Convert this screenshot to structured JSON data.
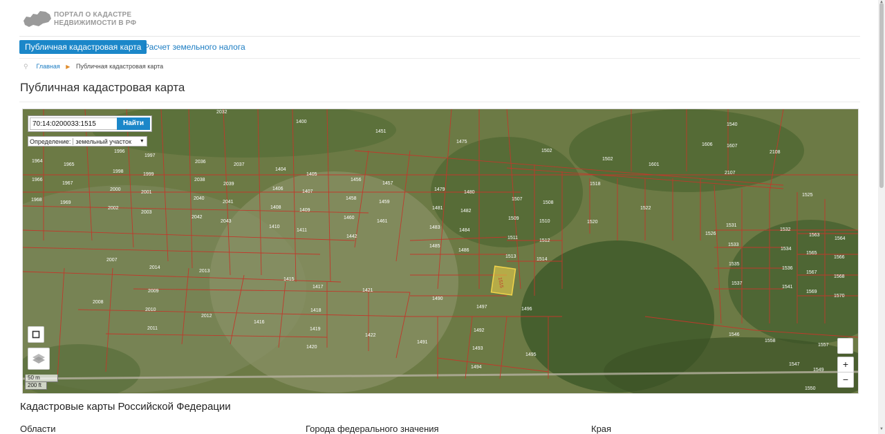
{
  "header": {
    "logo_line1": "ПОРТАЛ О КАДАСТРЕ",
    "logo_line2": "НЕДВИЖИМОСТИ В РФ"
  },
  "nav": {
    "tabs": [
      {
        "label": "Публичная кадастровая карта",
        "active": true
      },
      {
        "label": "Расчет земельного налога",
        "active": false
      }
    ]
  },
  "breadcrumb": {
    "home": "Главная",
    "current": "Публичная кадастровая карта"
  },
  "page_title": "Публичная кадастровая карта",
  "map": {
    "search_value": "70:14:0200033:1515",
    "search_button": "Найти",
    "definition_label": "Определение:",
    "definition_value": "земельный участок",
    "scale_metric": "50 m",
    "scale_imperial": "200 ft",
    "zoom_in": "+",
    "zoom_out": "−",
    "highlighted_parcel": "1515",
    "parcel_labels": [
      "2032",
      "1400",
      "1451",
      "1475",
      "1502",
      "1502",
      "1601",
      "2107",
      "1540",
      "1607",
      "2108",
      "1606",
      "1996",
      "1997",
      "1964",
      "1965",
      "1998",
      "1999",
      "1966",
      "1967",
      "2000",
      "2001",
      "1968",
      "1969",
      "2002",
      "2003",
      "2036",
      "2037",
      "2038",
      "2039",
      "2040",
      "2041",
      "2042",
      "2043",
      "1404",
      "1405",
      "1406",
      "1407",
      "1408",
      "1409",
      "1410",
      "1411",
      "1456",
      "1457",
      "1458",
      "1459",
      "1460",
      "1461",
      "1442",
      "1479",
      "1480",
      "1481",
      "1482",
      "1483",
      "1484",
      "1485",
      "1486",
      "1507",
      "1508",
      "1509",
      "1510",
      "1511",
      "1512",
      "1513",
      "1514",
      "1518",
      "1520",
      "1522",
      "1526",
      "1531",
      "1532",
      "1533",
      "1534",
      "1535",
      "1536",
      "1537",
      "1541",
      "1563",
      "1564",
      "1565",
      "1566",
      "1567",
      "1568",
      "1569",
      "1570",
      "2007",
      "2014",
      "2013",
      "1415",
      "1417",
      "1421",
      "1490",
      "1497",
      "1496",
      "2009",
      "2008",
      "2010",
      "2011",
      "2012",
      "1416",
      "1418",
      "1419",
      "1420",
      "1422",
      "1491",
      "1492",
      "1493",
      "1494",
      "1495",
      "1546",
      "1558",
      "1557",
      "1547",
      "1549",
      "1550",
      "1525"
    ],
    "colors": {
      "parcel_border": "#c0392b",
      "highlight_fill": "#f2d44a",
      "accent": "#1b87c9"
    }
  },
  "section": {
    "title": "Кадастровые карты Российской Федерации",
    "columns": [
      "Области",
      "Города федерального значения",
      "Края"
    ]
  }
}
